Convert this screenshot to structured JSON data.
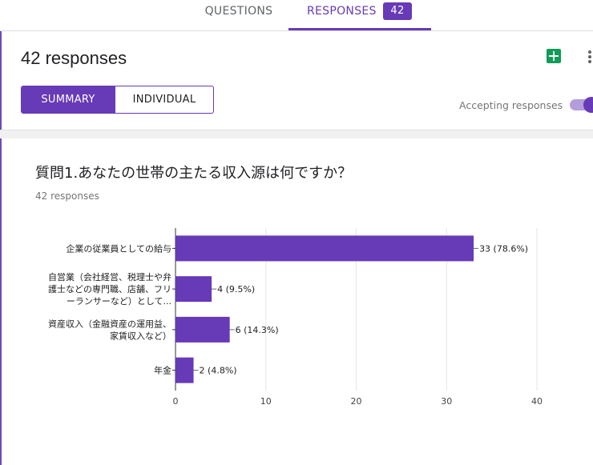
{
  "tabs": {
    "questions_label": "QUESTIONS",
    "responses_label": "RESPONSES",
    "responses_count": "42"
  },
  "header": {
    "title": "42 responses",
    "summary_label": "SUMMARY",
    "individual_label": "INDIVIDUAL",
    "accepting_label": "Accepting responses",
    "accepting_on": true
  },
  "icons": {
    "sheets": "google-sheets-icon",
    "more": "more-vert-icon"
  },
  "colors": {
    "accent": "#673ab7",
    "sheets_green": "#0f9d58"
  },
  "question": {
    "title": "質問1.あなたの世帯の主たる収入源は何ですか？",
    "responses_text": "42 responses"
  },
  "chart_data": {
    "type": "bar",
    "orientation": "horizontal",
    "categories": [
      [
        "企業の従業員としての給与"
      ],
      [
        "自営業（会社経営、税理士や弁",
        "護士などの専門職、店舗、フリ",
        "ーランサーなど）として..."
      ],
      [
        "資産収入（金融資産の運用益、",
        "家賃収入など）"
      ],
      [
        "年金"
      ]
    ],
    "values": [
      33,
      4,
      6,
      2
    ],
    "data_labels": [
      "33 (78.6%)",
      "4 (9.5%)",
      "6 (14.3%)",
      "2 (4.8%)"
    ],
    "xlim": [
      0,
      40
    ],
    "xticks": [
      0,
      10,
      20,
      30,
      40
    ],
    "grid": true,
    "bar_color": "#673ab7"
  }
}
